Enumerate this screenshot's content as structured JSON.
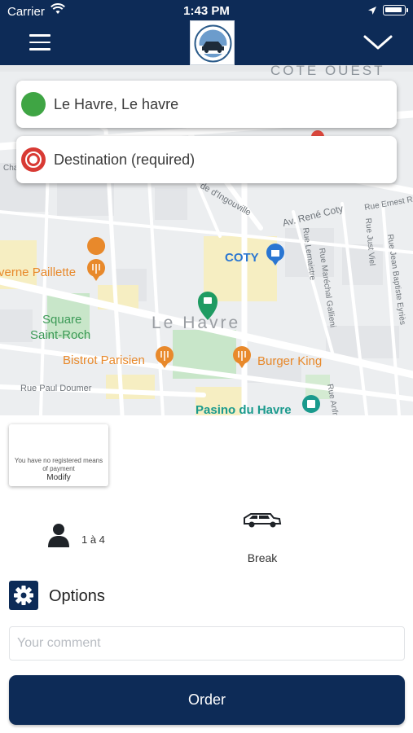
{
  "status_bar": {
    "carrier": "Carrier",
    "time": "1:43 PM"
  },
  "header": {
    "menu_icon": "hamburger-menu-icon",
    "logo": "taxi-company-logo",
    "collapse_icon": "chevron-down-icon"
  },
  "trip": {
    "pickup": {
      "text": "Le Havre, Le havre",
      "icon": "check-circle-icon",
      "color": "#3fa544"
    },
    "destination": {
      "placeholder": "Destination (required)",
      "icon": "record-dot-icon",
      "color": "#d83a34"
    }
  },
  "map": {
    "labels": {
      "district": "CÔTE OUEST",
      "city": "Le Havre",
      "square": [
        "Square",
        "Saint-Roch"
      ],
      "coty": "COTY",
      "bistrot": "Bistrot Parisien",
      "burger": "Burger King",
      "pasino": "Pasino du Havre",
      "paillette": "verne Paillette",
      "av_rene_coty": "Av. René Coty",
      "ingouville": "de d'Ingouville",
      "rue_paul_doumer": "Rue Paul Doumer",
      "rue_lemaistre": "Rue Lemaistre",
      "rue_marechal": "Rue Maréchal Gallieni",
      "rue_just_viel": "Rue Just Viel",
      "rue_jean_baptiste": "Rue Jean Baptiste Eyriès",
      "rue_ernest": "Rue Ernest Renai",
      "rue_anfray": "Rue Anfray",
      "cha": "Cha"
    },
    "colors": {
      "poi": "#e8892b",
      "park": "#3c9a57",
      "coty": "#2a76d2",
      "pasino": "#1a9a8d",
      "pin": "#1f9b62"
    }
  },
  "payment": {
    "message": "You have no registered means of payment",
    "action": "Modify"
  },
  "passengers": {
    "icon": "person-icon",
    "label": "1 à 4"
  },
  "vehicle": {
    "icon": "hearse-car-icon",
    "label": "Break"
  },
  "options": {
    "icon": "gear-icon",
    "label": "Options"
  },
  "comment": {
    "placeholder": "Your comment",
    "value": ""
  },
  "order": {
    "label": "Order"
  },
  "theme": {
    "navy": "#0d2b57"
  }
}
